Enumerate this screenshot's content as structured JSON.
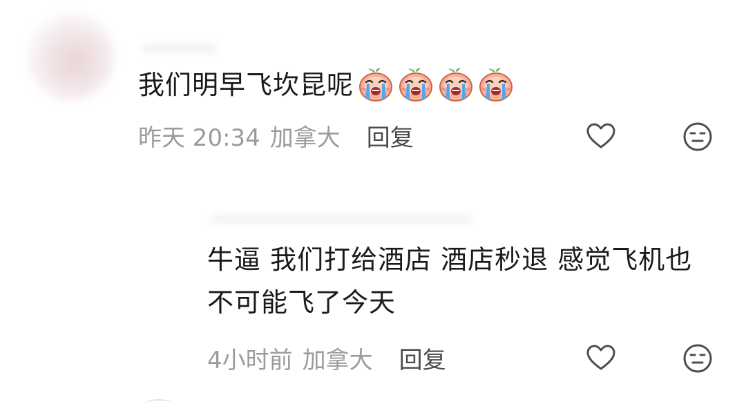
{
  "comments": [
    {
      "text": "我们明早飞坎昆呢",
      "emoji": [
        "crying-peach-emoji",
        "crying-peach-emoji",
        "crying-peach-emoji",
        "crying-peach-emoji"
      ],
      "time": "昨天 20:34",
      "location": "加拿大",
      "reply_label": "回复",
      "like_icon": "heart-outline-icon",
      "dislike_icon": "neutral-face-icon"
    },
    {
      "text": "牛逼 我们打给酒店 酒店秒退 感觉飞机也不可能飞了今天",
      "time": "4小时前",
      "location": "加拿大",
      "reply_label": "回复",
      "like_icon": "heart-outline-icon",
      "dislike_icon": "neutral-face-icon"
    }
  ],
  "colors": {
    "text_primary": "#1a1a1a",
    "text_meta": "#9b9b9b",
    "reply_label": "#4a4a4a",
    "icon_stroke": "#4d4d4d"
  }
}
